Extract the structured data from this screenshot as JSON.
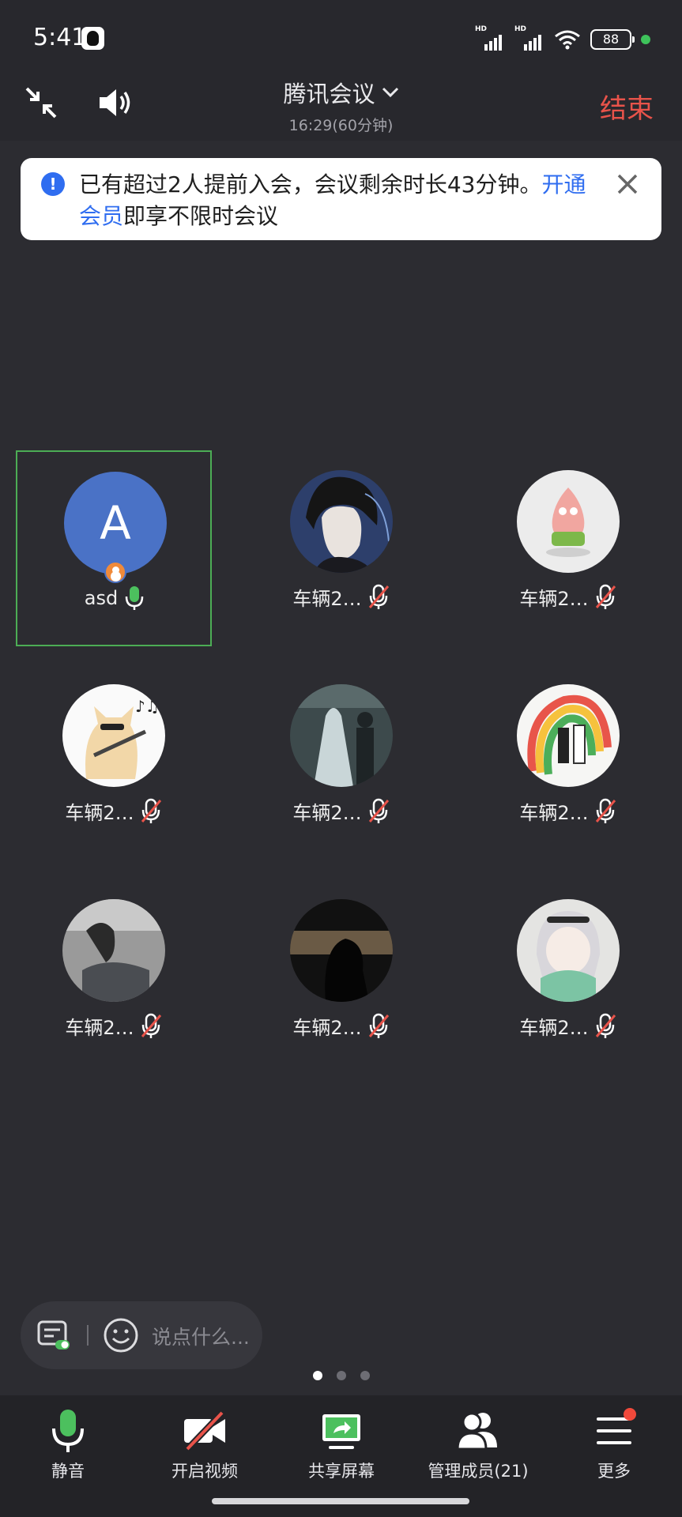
{
  "status_bar": {
    "time": "5:41",
    "battery": "88",
    "signal_label": "HD"
  },
  "header": {
    "title": "腾讯会议",
    "duration": "16:29(60分钟)",
    "end_label": "结束"
  },
  "banner": {
    "text": "已有超过2人提前入会，会议剩余时长43分钟。",
    "link": "开通会员",
    "suffix": "即享不限时会议"
  },
  "participants": [
    {
      "name": "asd",
      "initial": "A",
      "mic": "on",
      "host": true
    },
    {
      "name": "车辆2…",
      "mic": "off",
      "avatar": "dark-haired-illustration"
    },
    {
      "name": "车辆2…",
      "mic": "off",
      "avatar": "starfish-cartoon"
    },
    {
      "name": "车辆2…",
      "mic": "off",
      "avatar": "cat-with-guitar"
    },
    {
      "name": "车辆2…",
      "mic": "off",
      "avatar": "wedding-photo"
    },
    {
      "name": "车辆2…",
      "mic": "off",
      "avatar": "rainbow-couple"
    },
    {
      "name": "车辆2…",
      "mic": "off",
      "avatar": "person-sitting"
    },
    {
      "name": "车辆2…",
      "mic": "off",
      "avatar": "silhouette-window"
    },
    {
      "name": "车辆2…",
      "mic": "off",
      "avatar": "anime-girl-scarf"
    }
  ],
  "chat": {
    "placeholder": "说点什么..."
  },
  "pager": {
    "count": 3,
    "active": 0
  },
  "toolbar": {
    "mute": "静音",
    "video": "开启视频",
    "share": "共享屏幕",
    "members": "管理成员(21)",
    "more": "更多"
  },
  "colors": {
    "accent_blue": "#2f6df0",
    "end_red": "#e8534a",
    "mic_green": "#4cc05e",
    "active_border": "#4cad55"
  }
}
